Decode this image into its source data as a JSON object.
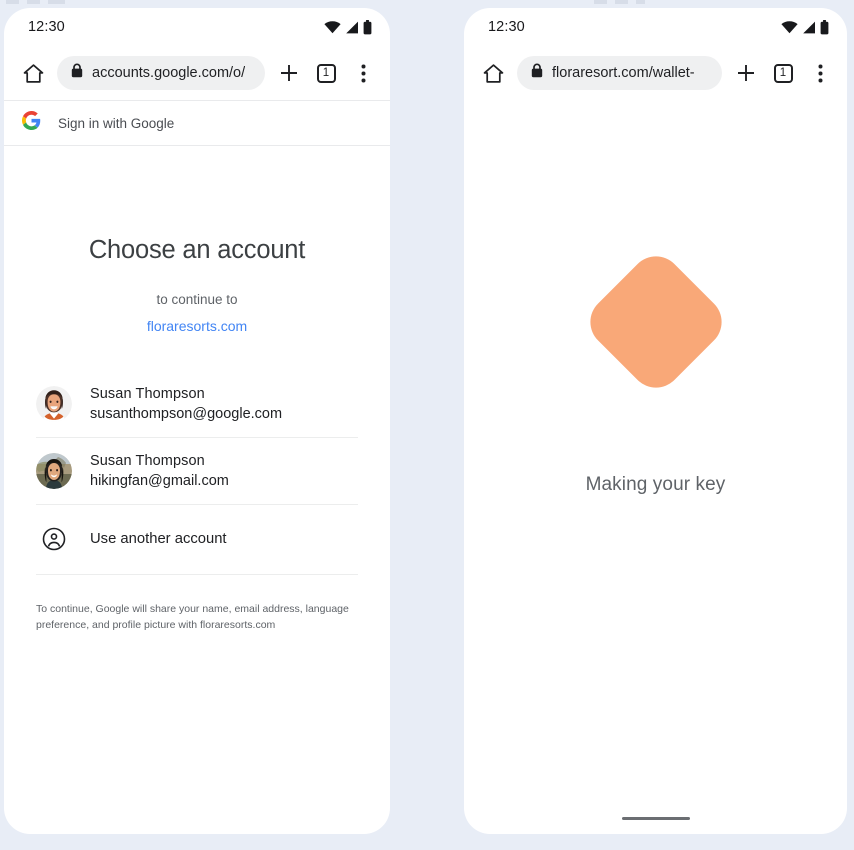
{
  "background_color": "#e8edf6",
  "phones": [
    {
      "id": "left",
      "status": {
        "time": "12:30",
        "wifi_icon": "wifi-icon",
        "signal_icon": "signal-icon",
        "battery_icon": "battery-icon"
      },
      "toolbar": {
        "home_icon": "home-icon",
        "lock_icon": "lock-icon",
        "url": "accounts.google.com/o/",
        "new_tab_icon": "plus-icon",
        "tab_count": "1",
        "menu_icon": "more-vertical-icon"
      },
      "google_header": {
        "logo_icon": "google-g-icon",
        "label": "Sign in with Google"
      },
      "chooser": {
        "title": "Choose an account",
        "subtitle": "to continue to",
        "domain": "floraresorts.com",
        "accounts": [
          {
            "name": "Susan Thompson",
            "email": "susanthompson@google.com",
            "avatar": "avatar-susan-google"
          },
          {
            "name": "Susan Thompson",
            "email": "hikingfan@gmail.com",
            "avatar": "avatar-susan-gmail"
          }
        ],
        "another_account": {
          "icon": "account-circle-icon",
          "label": "Use another account"
        },
        "disclaimer": "To continue, Google will share your name, email address, language preference, and profile picture with floraresorts.com"
      },
      "home_indicator": false
    },
    {
      "id": "right",
      "status": {
        "time": "12:30",
        "wifi_icon": "wifi-icon",
        "signal_icon": "signal-icon",
        "battery_icon": "battery-icon"
      },
      "toolbar": {
        "home_icon": "home-icon",
        "lock_icon": "lock-icon",
        "url": "floraresort.com/wallet-",
        "new_tab_icon": "plus-icon",
        "tab_count": "1",
        "menu_icon": "more-vertical-icon"
      },
      "making_key": {
        "shape_icon": "rounded-diamond-key-icon",
        "shape_color": "#f9a878",
        "label": "Making your key"
      },
      "home_indicator": true
    }
  ],
  "colors": {
    "accent_link": "#4285f4",
    "orange_key": "#f9a878",
    "page_bg": "#e8edf6",
    "text_primary": "#202124",
    "text_secondary": "#5f6368"
  }
}
